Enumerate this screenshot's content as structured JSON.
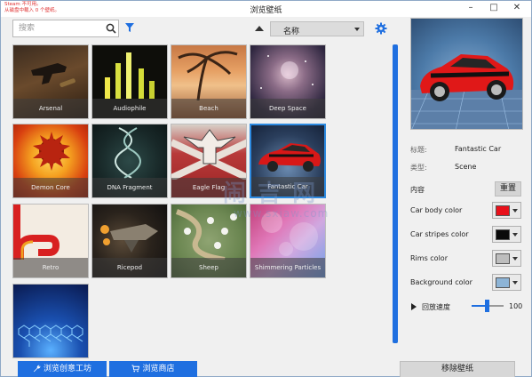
{
  "window": {
    "title": "浏览壁纸",
    "steam_warning_line1": "Steam 不可用。",
    "steam_warning_line2": "从磁盘中载入 0 个壁纸。",
    "minimize": "–",
    "maximize": "□",
    "close": "✕"
  },
  "toolbar": {
    "search_placeholder": "搜索",
    "search_icon": "search-icon",
    "filter_icon": "filter-icon",
    "sort_direction_icon": "sort-ascending-icon",
    "sort_value": "名称",
    "settings_icon": "gear-icon"
  },
  "wallpapers": [
    {
      "title": "Arsenal"
    },
    {
      "title": "Audiophile"
    },
    {
      "title": "Beach"
    },
    {
      "title": "Deep Space"
    },
    {
      "title": "Demon Core"
    },
    {
      "title": "DNA Fragment"
    },
    {
      "title": "Eagle Flag"
    },
    {
      "title": "Fantastic Car",
      "selected": true
    },
    {
      "title": "Retro"
    },
    {
      "title": "Ricepod"
    },
    {
      "title": "Sheep"
    },
    {
      "title": "Shimmering Particles"
    },
    {
      "title": ""
    }
  ],
  "details": {
    "title_label": "标题:",
    "title_value": "Fantastic Car",
    "type_label": "类型:",
    "type_value": "Scene",
    "content_label": "内容",
    "reset_label": "重置",
    "colors": [
      {
        "label": "Car body color",
        "value": "#e8101a"
      },
      {
        "label": "Car stripes color",
        "value": "#0a0a0a"
      },
      {
        "label": "Rims color",
        "value": "#bdbdbd"
      },
      {
        "label": "Background color",
        "value": "#8db4d6"
      }
    ],
    "speed_label": "回放速度",
    "speed_value": "100",
    "speed_level": 0.5
  },
  "bottom": {
    "workshop_label": "浏览创意工坊",
    "workshop_icon": "wrench-icon",
    "store_label": "浏览商店",
    "store_icon": "cart-icon",
    "remove_label": "移除壁纸"
  },
  "accent_color": "#1f6fe0",
  "watermark": {
    "line1": "闹 吉 网",
    "line2": "www.sxiaw.com"
  }
}
